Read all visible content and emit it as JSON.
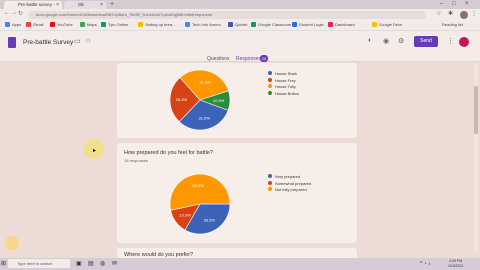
{
  "browser": {
    "tabs": [
      {
        "title": "Pre-battle survey - Google Forms"
      },
      {
        "title": "Ok"
      }
    ],
    "url": "docs.google.com/forms/d/1W5wbedhudR8X1pBdrs_76e5F_fLhvhbm0Tq4n8ZqjiMfr/edit#responses",
    "bookmarks": [
      "Apps",
      "Gmail",
      "YouTube",
      "Maps",
      "Tyto Online",
      "Setting up brea...",
      "Tech Info Ammo",
      "Quizlet",
      "Google Classroom",
      "Student Login",
      "Dashboard",
      "Google Drive",
      "Reading list"
    ]
  },
  "form": {
    "title": "Pre-battle Survey",
    "send_label": "Send",
    "tabs": {
      "questions": "Questions",
      "responses": "Responses",
      "responses_count": "20"
    }
  },
  "questions": [
    {
      "legend": [
        "House Stark",
        "House Frey",
        "House Tully",
        "House Bolton"
      ],
      "colors": [
        "#3c63b8",
        "#d84315",
        "#ff9800",
        "#2e8b3a"
      ],
      "values": [
        31.6,
        26.3,
        31.6,
        10.5
      ],
      "labels": [
        "31.6%",
        "26.3%",
        "31.6%",
        "10.5%"
      ]
    },
    {
      "title": "How prepared do you feel for battle?",
      "subtitle": "15 responses",
      "legend": [
        "Very prepared",
        "Somewhat prepared",
        "Not fully prepared"
      ],
      "colors": [
        "#3c63b8",
        "#d84315",
        "#ff9800"
      ],
      "values": [
        33.3,
        13.3,
        53.3
      ],
      "labels": [
        "33.3%",
        "13.3%",
        "53.3%"
      ]
    },
    {
      "title": "Where would do you prefer?"
    }
  ],
  "chart_data": [
    {
      "type": "pie",
      "categories": [
        "House Stark",
        "House Frey",
        "House Tully",
        "House Bolton"
      ],
      "values": [
        31.6,
        26.3,
        31.6,
        10.5
      ]
    },
    {
      "type": "pie",
      "title": "How prepared do you feel for battle?",
      "categories": [
        "Very prepared",
        "Somewhat prepared",
        "Not fully prepared"
      ],
      "values": [
        33.3,
        13.3,
        53.3
      ]
    }
  ],
  "taskbar": {
    "search_placeholder": "Type here to search",
    "time": "2:05 PM",
    "date": "1/15/2021"
  }
}
